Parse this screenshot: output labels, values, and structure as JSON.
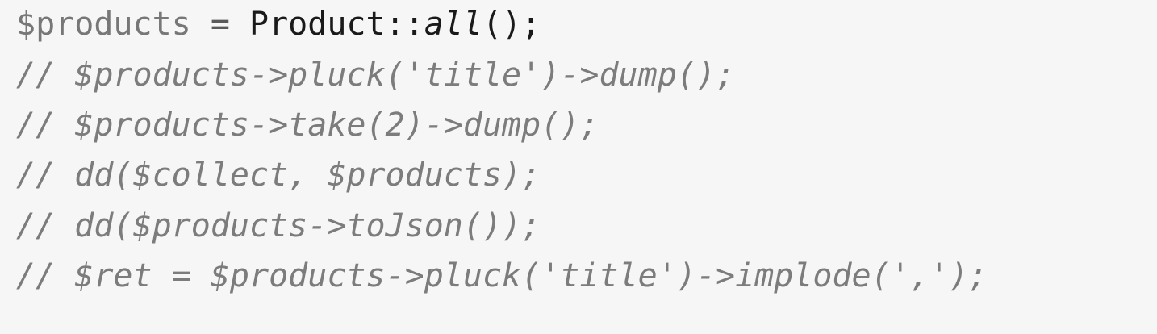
{
  "code": {
    "lines": [
      {
        "variable": "$products",
        "operator": " = ",
        "class_call": "Product::",
        "method": "all",
        "tail": "();"
      },
      {
        "text": "// $products->pluck('title')->dump();"
      },
      {
        "text": "// $products->take(2)->dump();"
      },
      {
        "text": "// dd($collect, $products);"
      },
      {
        "text": "// dd($products->toJson());"
      },
      {
        "text": "// $ret = $products->pluck('title')->implode(',');"
      }
    ]
  }
}
